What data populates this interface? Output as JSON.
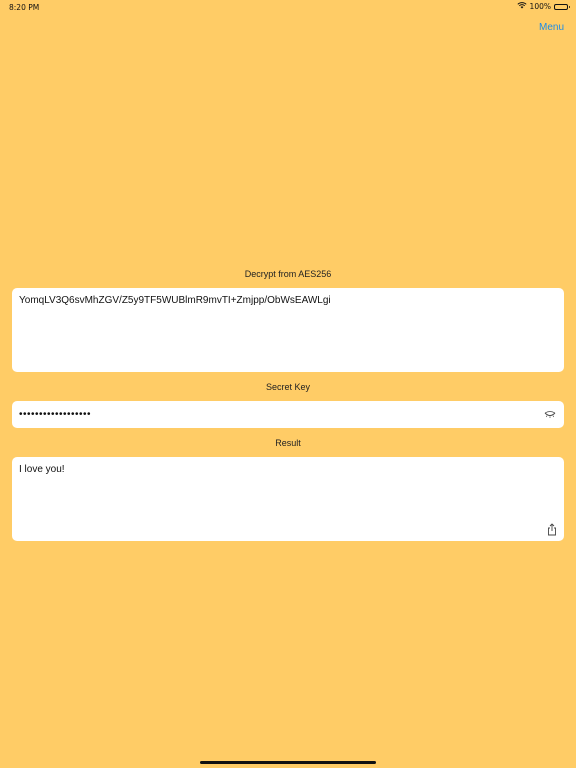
{
  "status_bar": {
    "time": "8:20 PM",
    "battery": "100%"
  },
  "nav": {
    "menu_label": "Menu"
  },
  "decrypt": {
    "label": "Decrypt from AES256",
    "ciphertext": "YomqLV3Q6svMhZGV/Z5y9TF5WUBlmR9mvTI+Zmjpp/ObWsEAWLgi"
  },
  "secret_key": {
    "label": "Secret Key",
    "masked_value": "••••••••••••••••••"
  },
  "result": {
    "label": "Result",
    "value": "I love you!"
  },
  "colors": {
    "background": "#FFCC66",
    "accent": "#1E8CE6",
    "field": "#FFFFFF"
  },
  "icons": [
    "wifi-icon",
    "battery-icon",
    "eye-closed-icon",
    "share-icon"
  ]
}
